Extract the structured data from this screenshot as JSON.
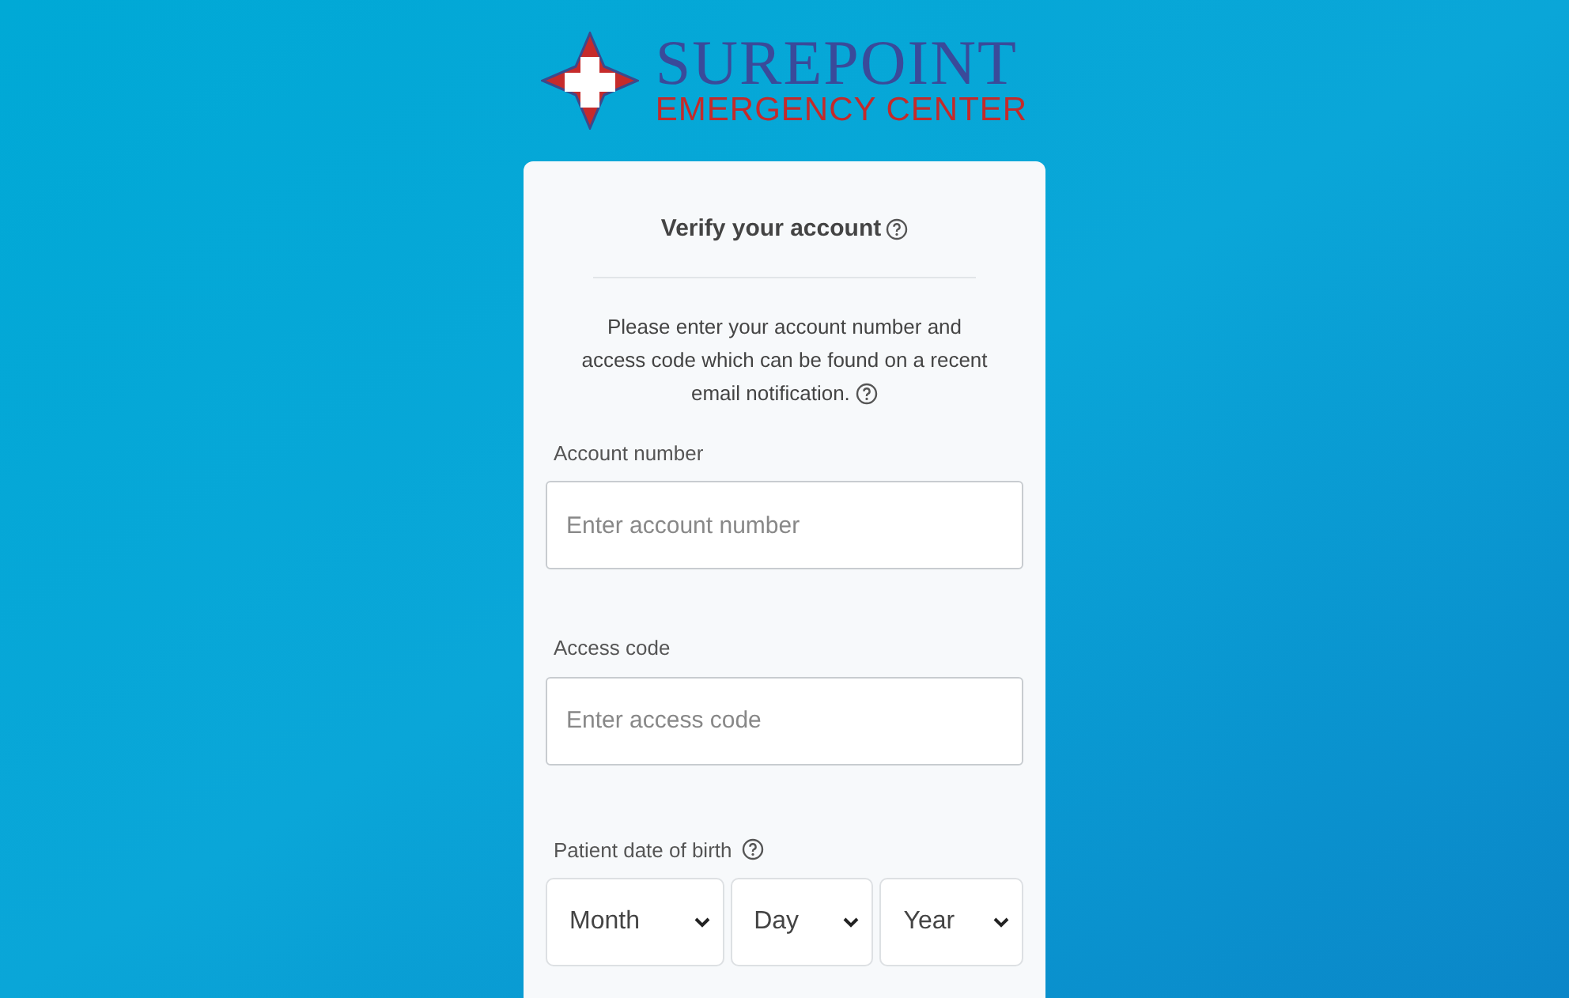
{
  "logo": {
    "name": "SUREPOINT",
    "tagline": "EMERGENCY CENTER"
  },
  "card": {
    "title": "Verify your account",
    "intro": "Please enter your account number and access code which can be found on a recent email notification.",
    "fields": [
      {
        "label": "Account number",
        "placeholder": "Enter account number"
      },
      {
        "label": "Access code",
        "placeholder": "Enter access code"
      }
    ],
    "date_of_birth": {
      "label": "Patient date of birth",
      "selects": [
        "Month",
        "Day",
        "Year"
      ]
    }
  }
}
